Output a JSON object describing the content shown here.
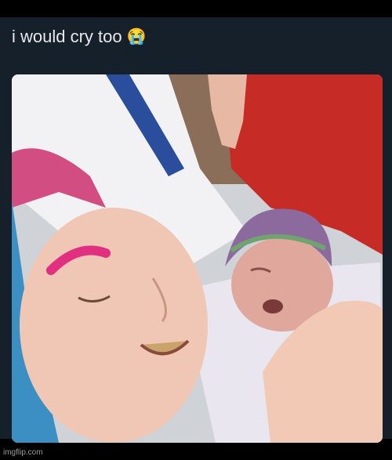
{
  "post": {
    "caption": "i would cry too",
    "caption_emoji": "😭",
    "emoji_name": "loudly-crying-face-icon"
  },
  "photo": {
    "description_name": "newborn-photo"
  },
  "watermark": {
    "text": "imgflip.com"
  },
  "colors": {
    "background": "#000000",
    "post_bg": "#15202b",
    "caption_text": "#e7e9ea"
  }
}
